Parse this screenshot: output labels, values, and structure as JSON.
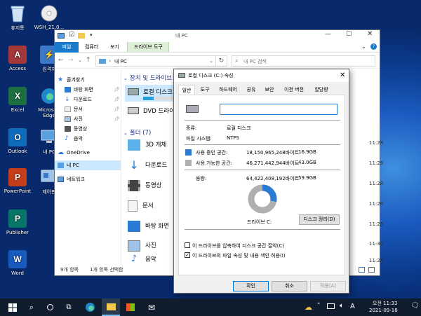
{
  "desktop": {
    "icons": [
      {
        "label": "휴지통",
        "icon": "recycle-bin-icon",
        "color": "#9fc3e6"
      },
      {
        "label": "WSH_21.0...",
        "icon": "disc-icon",
        "color": "#e8e8e8"
      },
      {
        "label": "Access",
        "icon": "access-icon",
        "color": "#a4373a"
      },
      {
        "label": "원격지",
        "icon": "remote-icon",
        "color": "#3b78c9"
      },
      {
        "label": "Excel",
        "icon": "excel-icon",
        "color": "#1d6f42"
      },
      {
        "label": "Microsoft Edge",
        "icon": "edge-icon",
        "color": "#1e87c9"
      },
      {
        "label": "Outlook",
        "icon": "outlook-icon",
        "color": "#0f6cbd"
      },
      {
        "label": "내 PC",
        "icon": "pc-icon",
        "color": "#5aa0e0"
      },
      {
        "label": "PowerPoint",
        "icon": "powerpoint-icon",
        "color": "#c43e1c"
      },
      {
        "label": "제어판",
        "icon": "control-panel-icon",
        "color": "#5aa0e0"
      },
      {
        "label": "Publisher",
        "icon": "publisher-icon",
        "color": "#077568"
      },
      {
        "label": "Word",
        "icon": "word-icon",
        "color": "#185abd"
      }
    ]
  },
  "explorer": {
    "window_title": "내 PC",
    "context_tab": "관리",
    "ribbon_tabs": [
      "파일",
      "컴퓨터",
      "보기",
      "드라이브 도구"
    ],
    "address": "내 PC",
    "search_placeholder": "내 PC 검색",
    "nav_items": [
      {
        "label": "즐겨찾기",
        "icon": "star-icon",
        "pinned": false
      },
      {
        "label": "바탕 화면",
        "icon": "desktop-icon",
        "pinned": true
      },
      {
        "label": "다운로드",
        "icon": "download-icon",
        "pinned": true
      },
      {
        "label": "문서",
        "icon": "document-icon",
        "pinned": true
      },
      {
        "label": "사진",
        "icon": "pictures-icon",
        "pinned": true
      },
      {
        "label": "동영상",
        "icon": "videos-icon",
        "pinned": false
      },
      {
        "label": "음악",
        "icon": "music-icon",
        "pinned": false
      },
      {
        "label": "OneDrive",
        "icon": "onedrive-icon",
        "pinned": false
      },
      {
        "label": "내 PC",
        "icon": "pc-icon",
        "pinned": false
      },
      {
        "label": "네트워크",
        "icon": "network-icon",
        "pinned": false
      }
    ],
    "drives_header": "장치 및 드라이브",
    "drives": [
      "로컬 디스크",
      "DVD 드라이"
    ],
    "folders_header": "폴더 (7)",
    "folders": [
      {
        "label": "3D 개체",
        "icon": "3d-objects-icon",
        "time": "11:28"
      },
      {
        "label": "다운로드",
        "icon": "download-icon",
        "time": "11:28"
      },
      {
        "label": "동영상",
        "icon": "videos-icon",
        "time": "11:28"
      },
      {
        "label": "문서",
        "icon": "document-icon",
        "time": "11:28"
      },
      {
        "label": "바탕 화면",
        "icon": "desktop-icon",
        "time": "11:28"
      },
      {
        "label": "사진",
        "icon": "pictures-icon",
        "time": "11:30"
      },
      {
        "label": "음악",
        "icon": "music-icon",
        "time": "11:28"
      }
    ],
    "status_items": "9개 항목",
    "status_selected": "1개 항목 선택함"
  },
  "dialog": {
    "title": "로컬 디스크 (C:) 속성",
    "tabs": [
      "일반",
      "도구",
      "하드웨어",
      "공유",
      "보안",
      "이전 버전",
      "할당량"
    ],
    "name_value": "",
    "type_label": "종류:",
    "type_value": "로컬 디스크",
    "fs_label": "파일 시스템:",
    "fs_value": "NTFS",
    "used_label": "사용 중인 공간:",
    "used_bytes": "18,150,965,248바이트",
    "used_gb": "16.9GB",
    "free_label": "사용 가능한 공간:",
    "free_bytes": "46,271,442,944바이트",
    "free_gb": "43.0GB",
    "cap_label": "용량:",
    "cap_bytes": "64,422,408,192바이트",
    "cap_gb": "59.9GB",
    "drive_label": "드라이브 C:",
    "cleanup_button": "디스크 정리(D)",
    "compress_label": "이 드라이브를 압축하여 디스크 공간 절약(C)",
    "compress_checked": false,
    "index_label": "이 드라이브의 파일 속성 및 내용 색인 허용(I)",
    "index_checked": true,
    "ok": "확인",
    "cancel": "취소",
    "apply": "적용(A)",
    "used_fraction": 0.282,
    "used_color": "#2a7bd4",
    "free_color": "#b0b0b0"
  },
  "taskbar": {
    "language": "A",
    "time": "오전 11:33",
    "date": "2021-09-18"
  }
}
